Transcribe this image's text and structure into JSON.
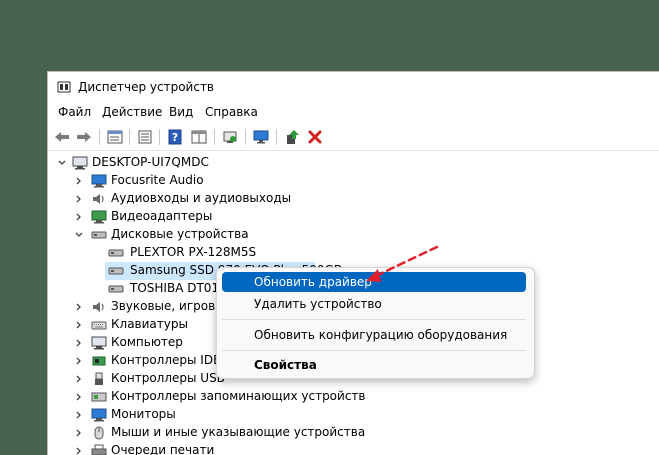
{
  "window": {
    "title": "Диспетчер устройств",
    "menu": [
      "Файл",
      "Действие",
      "Вид",
      "Справка"
    ]
  },
  "toolbar": {
    "icons": [
      "back-arrow-icon",
      "forward-arrow-icon",
      "properties-icon",
      "device-list-icon",
      "help-icon",
      "view-icon",
      "scan-icon",
      "monitor-icon",
      "update-driver-icon",
      "uninstall-icon"
    ]
  },
  "tree": {
    "root": "DESKTOP-UI7QMDC",
    "items": [
      {
        "label": "Focusrite Audio",
        "icon": "audio-device-icon"
      },
      {
        "label": "Аудиовходы и аудиовыходы",
        "icon": "speaker-icon"
      },
      {
        "label": "Видеоадаптеры",
        "icon": "display-adapter-icon"
      },
      {
        "label": "Дисковые устройства",
        "icon": "disk-drive-icon"
      },
      {
        "label": "PLEXTOR PX-128M5S",
        "icon": "disk-icon"
      },
      {
        "label": "Samsung SSD 970 EVO Plus 500GB",
        "icon": "disk-icon"
      },
      {
        "label": "TOSHIBA DT01ACA200",
        "icon": "disk-icon"
      },
      {
        "label": "Звуковые, игровые и видеоустройства",
        "icon": "sound-icon"
      },
      {
        "label": "Клавиатуры",
        "icon": "keyboard-icon"
      },
      {
        "label": "Компьютер",
        "icon": "computer-icon"
      },
      {
        "label": "Контроллеры IDE ATA/ATAPI",
        "icon": "ide-controller-icon"
      },
      {
        "label": "Контроллеры USB",
        "icon": "usb-icon"
      },
      {
        "label": "Контроллеры запоминающих устройств",
        "icon": "storage-controller-icon"
      },
      {
        "label": "Мониторы",
        "icon": "monitor-icon"
      },
      {
        "label": "Мыши и иные указывающие устройства",
        "icon": "mouse-icon"
      },
      {
        "label": "Очереди печати",
        "icon": "printer-icon"
      }
    ]
  },
  "context_menu": {
    "items": [
      "Обновить драйвер",
      "Удалить устройство",
      "Обновить конфигурацию оборудования",
      "Свойства"
    ]
  },
  "colors": {
    "desktop": "#49624f",
    "selection": "#cce8ff",
    "menu_highlight": "#0067c0",
    "annotation_arrow": "#e0202c"
  }
}
